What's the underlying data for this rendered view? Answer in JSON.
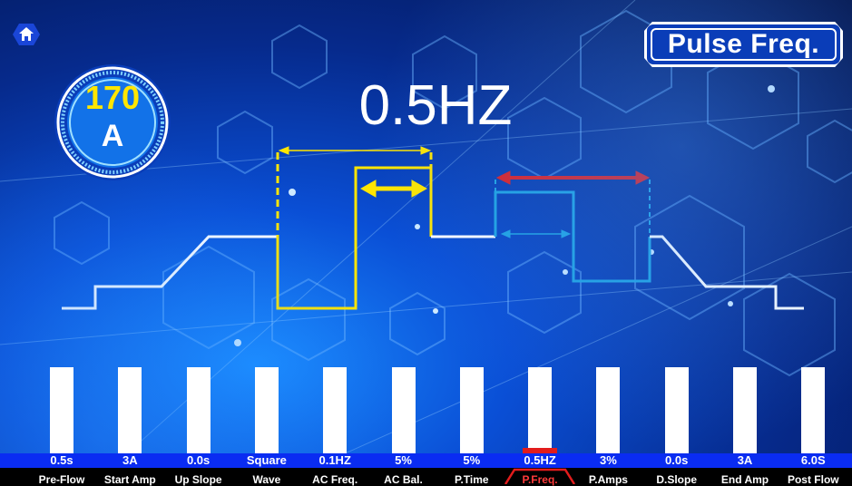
{
  "header": {
    "mode_title": "Pulse Freq."
  },
  "current": {
    "value": "170",
    "unit": "A"
  },
  "selected_value": "0.5HZ",
  "colors": {
    "accent_yellow": "#ffe600",
    "pulse_cyan": "#1fa3e0",
    "selected_red": "#e21c1c",
    "value_strip_blue": "#0a2cf2",
    "weld_curve_white": "#ffffff"
  },
  "icons": {
    "home": "home-icon",
    "dial": "amperage-dial-icon"
  },
  "parameters": [
    {
      "key": "pre-flow",
      "value": "0.5s",
      "label": "Pre-Flow"
    },
    {
      "key": "start-amp",
      "value": "3A",
      "label": "Start Amp"
    },
    {
      "key": "up-slope",
      "value": "0.0s",
      "label": "Up Slope"
    },
    {
      "key": "wave",
      "value": "Square",
      "label": "Wave"
    },
    {
      "key": "ac-freq",
      "value": "0.1HZ",
      "label": "AC Freq."
    },
    {
      "key": "ac-bal",
      "value": "5%",
      "label": "AC Bal."
    },
    {
      "key": "p-time",
      "value": "5%",
      "label": "P.Time"
    },
    {
      "key": "p-freq",
      "value": "0.5HZ",
      "label": "P.Freq.",
      "selected": true
    },
    {
      "key": "p-amps",
      "value": "3%",
      "label": "P.Amps"
    },
    {
      "key": "d-slope",
      "value": "0.0s",
      "label": "D.Slope"
    },
    {
      "key": "end-amp",
      "value": "3A",
      "label": "End Amp"
    },
    {
      "key": "post-flow",
      "value": "6.0S",
      "label": "Post Flow"
    }
  ]
}
